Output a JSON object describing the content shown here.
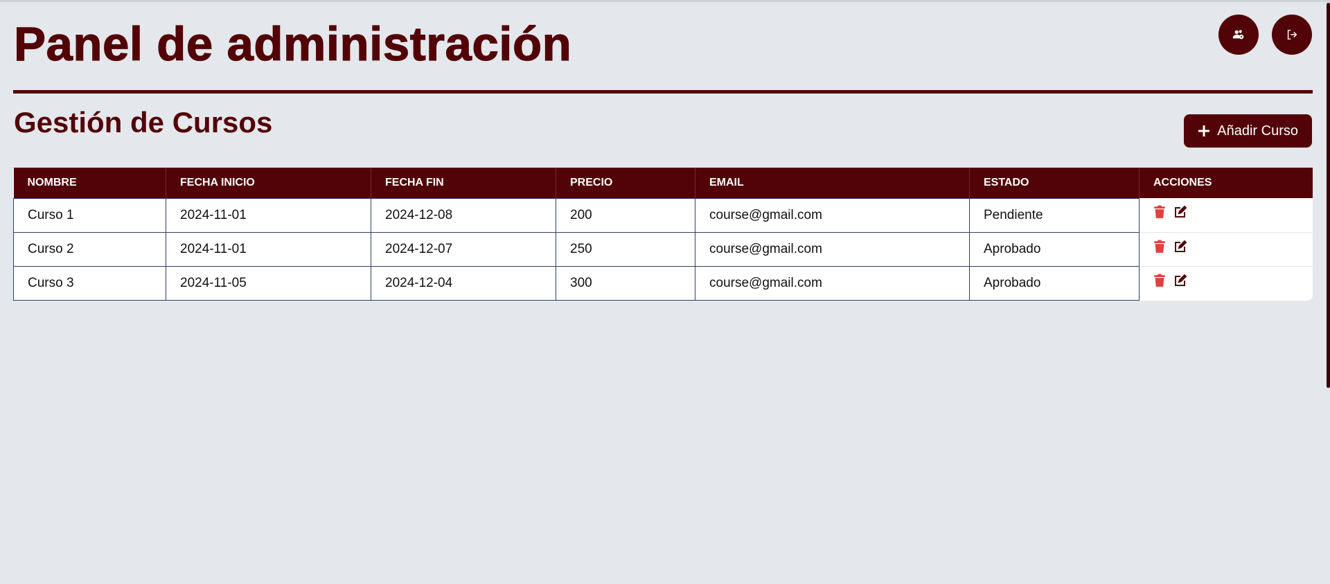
{
  "header": {
    "title": "Panel de administración",
    "user_admin_icon": "users-gear-icon",
    "logout_icon": "logout-icon"
  },
  "section": {
    "title": "Gestión de Cursos",
    "add_button_label": "Añadir Curso",
    "add_icon": "plus-icon"
  },
  "table": {
    "columns": [
      "NOMBRE",
      "FECHA INICIO",
      "FECHA FIN",
      "PRECIO",
      "EMAIL",
      "ESTADO",
      "ACCIONES"
    ],
    "rows": [
      {
        "nombre": "Curso 1",
        "fecha_inicio": "2024-11-01",
        "fecha_fin": "2024-12-08",
        "precio": "200",
        "email": "course@gmail.com",
        "estado": "Pendiente"
      },
      {
        "nombre": "Curso 2",
        "fecha_inicio": "2024-11-01",
        "fecha_fin": "2024-12-07",
        "precio": "250",
        "email": "course@gmail.com",
        "estado": "Aprobado"
      },
      {
        "nombre": "Curso 3",
        "fecha_inicio": "2024-11-05",
        "fecha_fin": "2024-12-04",
        "precio": "300",
        "email": "course@gmail.com",
        "estado": "Aprobado"
      }
    ],
    "row_actions": [
      "trash-icon",
      "edit-icon"
    ]
  },
  "colors": {
    "brand": "#520307",
    "background": "#e4e7eb",
    "delete": "#e53e3e"
  }
}
